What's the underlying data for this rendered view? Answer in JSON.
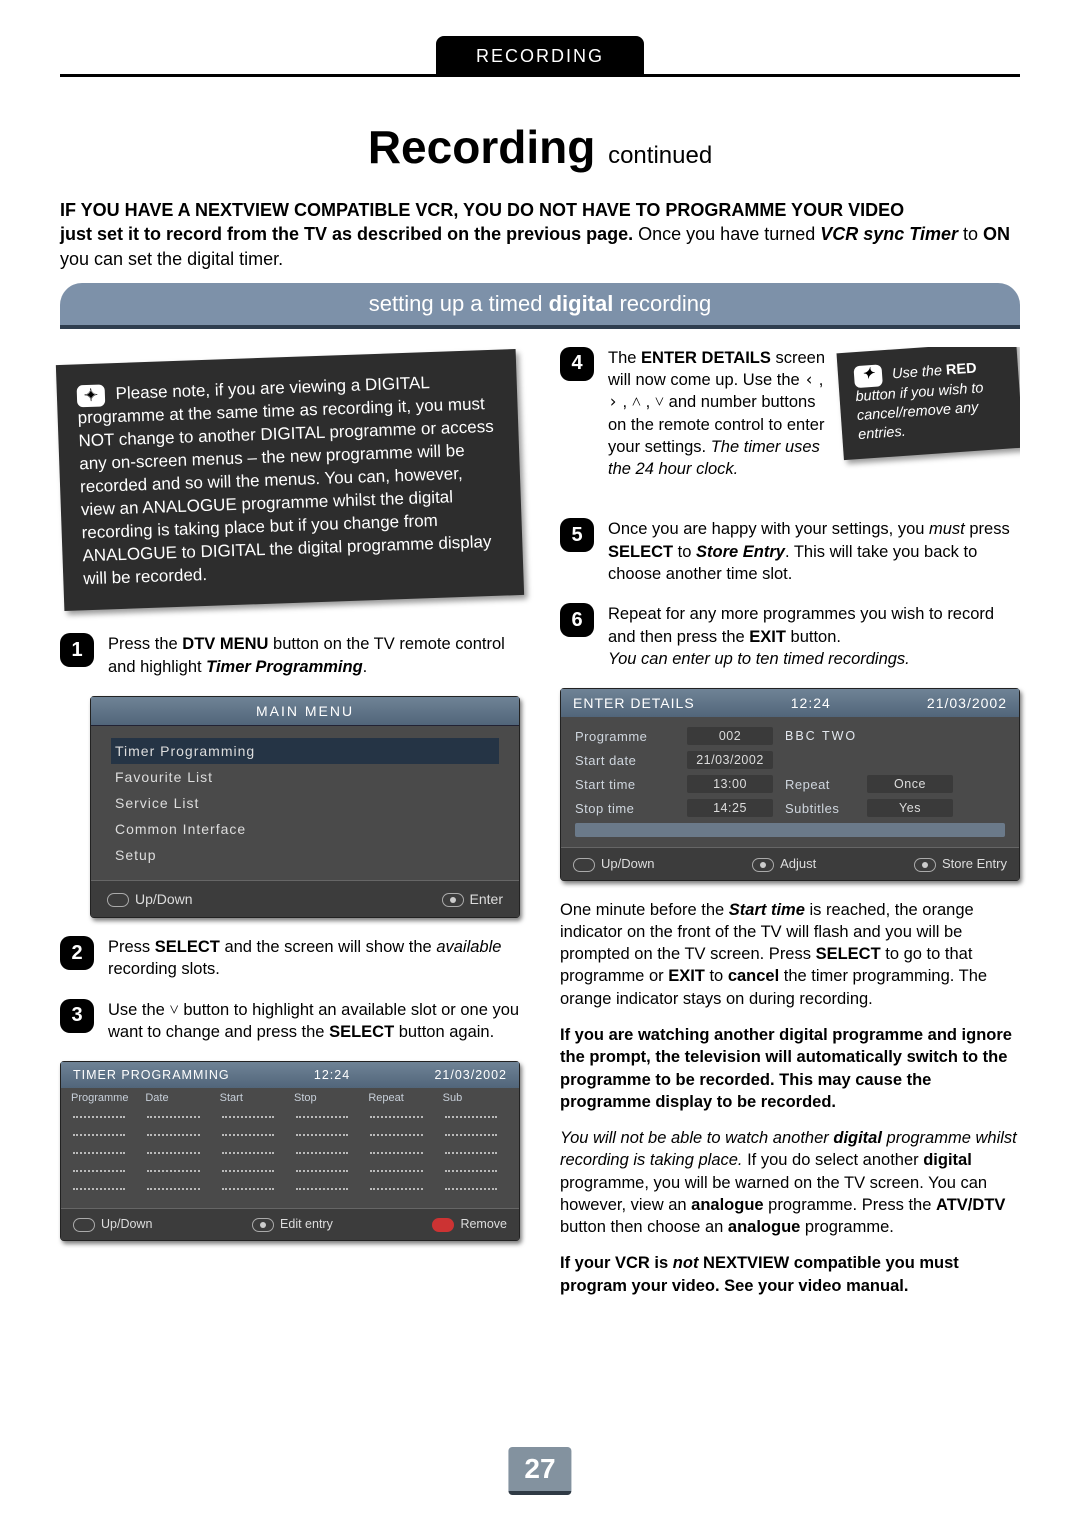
{
  "header_tab": "RECORDING",
  "title_main": "Recording",
  "title_cont": "continued",
  "intro": {
    "line1": "IF YOU HAVE A NEXTVIEW COMPATIBLE VCR, YOU DO NOT HAVE TO PROGRAMME YOUR VIDEO",
    "line2a": "just set it to record from the TV as described on the previous page.",
    "line2b": " Once you have turned ",
    "line2c": "VCR sync Timer",
    "line2d": " to ",
    "line2e": "ON",
    "line2f": " you can set the digital timer."
  },
  "section_bar": {
    "pre": "setting up a timed ",
    "bold": "digital",
    "post": " recording"
  },
  "note_card": "Please note, if you are viewing a DIGITAL programme at the same time as recording it, you must NOT change to another DIGITAL programme or access any on-screen menus – the new programme will be recorded and so will the menus. You can, however, view an ANALOGUE programme whilst the digital recording is taking place but if you change from ANALOGUE to DIGITAL the digital programme display will be recorded.",
  "steps_left": {
    "1": "Press the DTV MENU button on the TV remote control and highlight Timer Programming.",
    "2": "Press SELECT and the screen will show the available recording slots.",
    "3": "Use the ⌄ button to highlight an available slot or one you want to change and press the SELECT button again."
  },
  "steps_right": {
    "4": "The ENTER DETAILS screen will now come up. Use the ‹ , › , ˄ , ˅ and number buttons on the remote control to enter your settings. The timer uses the 24 hour clock.",
    "5": "Once you are happy with your settings, you must press SELECT to Store Entry. This will take you back to choose another time slot.",
    "6": "Repeat for any more programmes you wish to record and then press the EXIT button.",
    "postline": "You can enter up to ten timed recordings."
  },
  "small_note": {
    "pre": "Use the ",
    "bold": "RED",
    "post": " button if you wish to cancel/remove any entries."
  },
  "main_menu": {
    "title": "MAIN MENU",
    "items": [
      "Timer Programming",
      "Favourite List",
      "Service List",
      "Common Interface",
      "Setup"
    ],
    "footer_left": "Up/Down",
    "footer_right": "Enter"
  },
  "tp_panel": {
    "title": "TIMER PROGRAMMING",
    "time": "12:24",
    "date": "21/03/2002",
    "cols": [
      "Programme",
      "Date",
      "Start",
      "Stop",
      "Repeat",
      "Sub"
    ],
    "footer": {
      "left": "Up/Down",
      "mid": "Edit entry",
      "right": "Remove"
    }
  },
  "ed_panel": {
    "title": "ENTER DETAILS",
    "time": "12:24",
    "date": "21/03/2002",
    "rows": {
      "programme": {
        "label": "Programme",
        "val": "002",
        "text": "BBC TWO"
      },
      "startdate": {
        "label": "Start date",
        "val": "21/03/2002"
      },
      "starttime": {
        "label": "Start time",
        "val": "13:00",
        "lab2": "Repeat",
        "val2": "Once"
      },
      "stoptime": {
        "label": "Stop time",
        "val": "14:25",
        "lab2": "Subtitles",
        "val2": "Yes"
      }
    },
    "footer": {
      "left": "Up/Down",
      "mid": "Adjust",
      "right": "Store Entry"
    }
  },
  "paras": {
    "p1a": "One minute before the ",
    "p1b": "Start time",
    "p1c": " is reached, the orange indicator on the front of the TV will flash and you will be prompted on the TV screen. Press ",
    "p1d": "SELECT",
    "p1e": " to go to that programme or ",
    "p1f": "EXIT",
    "p1g": " to ",
    "p1h": "cancel",
    "p1i": " the timer programming. The orange indicator stays on during recording.",
    "p2": "If you are watching another digital programme and ignore the prompt, the television will automatically switch to the programme to be recorded. This may cause the programme display to be recorded.",
    "p3a": "You will not be able to watch another ",
    "p3b": "digital",
    "p3c": " programme whilst recording is taking place.",
    "p3d": " If you do select another ",
    "p3e": "digital",
    "p3f": " programme, you will be warned on the TV screen. You can however, view an ",
    "p3g": "analogue",
    "p3h": " programme. Press the ",
    "p3i": "ATV/DTV",
    "p3j": " button then choose an ",
    "p3k": "analogue",
    "p3l": " programme.",
    "p4a": "If your VCR is ",
    "p4b": "not",
    "p4c": " NEXTVIEW compatible you must program your video. See your video manual."
  },
  "page_number": "27"
}
